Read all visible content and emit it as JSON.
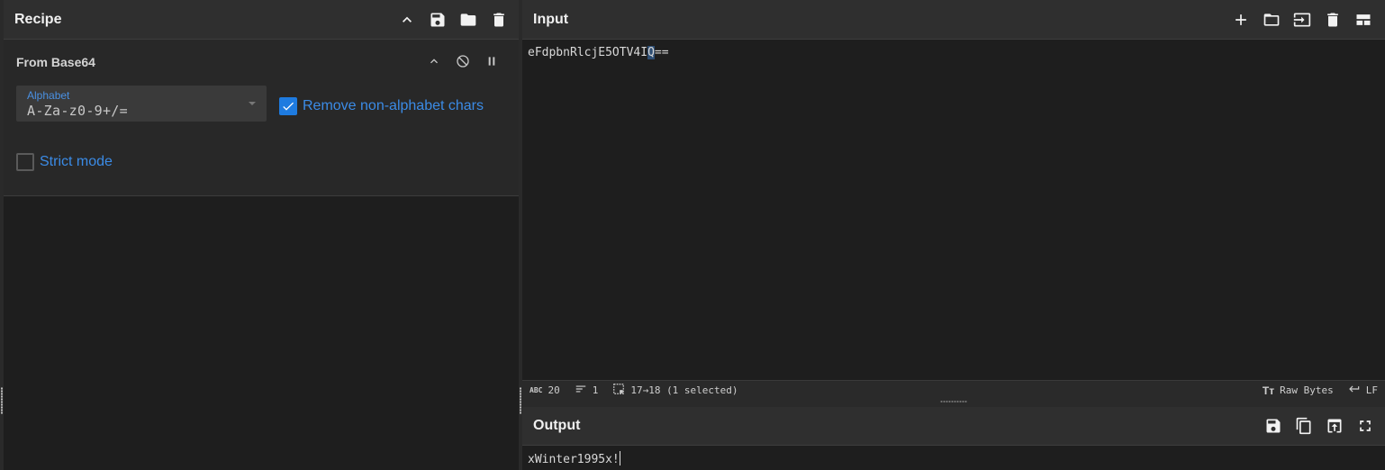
{
  "recipe": {
    "title": "Recipe",
    "operation": {
      "name": "From Base64",
      "alphabet_label": "Alphabet",
      "alphabet_value": "A-Za-z0-9+/=",
      "remove_non_alphabet_label": "Remove non-alphabet chars",
      "remove_non_alphabet_checked": true,
      "strict_mode_label": "Strict mode",
      "strict_mode_checked": false
    }
  },
  "input": {
    "title": "Input",
    "text_before": "eFdpbnRlcjE5OTV4I",
    "text_selected": "Q",
    "text_after": "==",
    "status": {
      "length": "20",
      "lines": "1",
      "selection": "17→18 (1 selected)",
      "encoding": "Raw Bytes",
      "eol": "LF"
    }
  },
  "output": {
    "title": "Output",
    "text": "xWinter1995x!"
  },
  "colors": {
    "accent": "#1e7be0",
    "link": "#3b8be6",
    "header_bg": "#2f2f2f",
    "panel_bg": "#1e1e1e"
  }
}
